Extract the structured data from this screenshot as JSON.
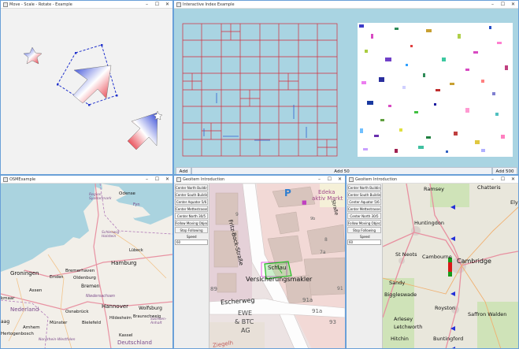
{
  "win1": {
    "title": "Move - Scale - Rotate - Example"
  },
  "win2": {
    "title": "Interactive Index Example",
    "buttons": {
      "add": "Add",
      "add50": "Add 50",
      "add500": "Add 500"
    }
  },
  "win3": {
    "title": "OSMExample",
    "labels": {
      "odense": "Odense",
      "fyn": "Fyn",
      "syddanmark": "Region Syddanmark",
      "schleswig": "Schleswig-Holstein",
      "lubeck": "Lübeck",
      "hamburg": "Hamburg",
      "groningen": "Groningen",
      "bremerhaven": "Bremerhaven",
      "oldenburg": "Oldenburg",
      "bremen": "Bremen",
      "emden": "Emden",
      "assen": "Assen",
      "niedersachsen": "Niedersachsen",
      "hannover": "Hannover",
      "wolfsburg": "Wolfsburg",
      "braunschweig": "Braunschweig",
      "osnabruck": "Osnabrück",
      "bielefeld": "Bielefeld",
      "munster": "Münster",
      "arnhem": "Arnhem",
      "hildesheim": "Hildesheim",
      "sachsen_anhalt": "Sachsen-Anhalt",
      "hertogenbosch": "Hertogenbosch",
      "nederland": "Nederland",
      "deutschland": "Deutschland",
      "nrw": "Nordrhein-Westfalen",
      "kmaar": "kmaar",
      "aag": "aag",
      "kassel": "Kassel"
    }
  },
  "win4": {
    "title": "Geoitem Introduction",
    "buttons": [
      "Center North Building",
      "Center South Building",
      "Center Aquator 5/6",
      "Center Mettestrasse 10/6",
      "Center North 30/5",
      "Follow Moving Object",
      "Stop Following",
      "Speed"
    ],
    "speed": "60",
    "labels": {
      "edeka": "Edeka",
      "aktiv_markt": "aktiv Markt",
      "fritz_bock": "Fritz-Bock-Straße",
      "escherweg": "Escherweg",
      "versicherungsmakler": "Versicherungsmakler",
      "ewe": "EWE",
      "btc": "& BTC",
      "ag": "AG",
      "n9": "9",
      "n89": "89",
      "n91a": "91a",
      "n91a2": "91a",
      "n91": "91",
      "n93": "93",
      "n8": "8",
      "n7a": "7a",
      "n7c": "7c",
      "n9b": "9b",
      "schlau": "Schlau",
      "stra_e": "Straße",
      "ziegelh": "Ziegelh"
    }
  },
  "win5": {
    "title": "Geoitem Introduction",
    "buttons": [
      "Center North Building",
      "Center South Building",
      "Center Aquator 5/6",
      "Center Mettestrasse 10/6",
      "Center North 30/5",
      "Follow Moving Object",
      "Stop Following",
      "Speed"
    ],
    "speed": "60",
    "labels": {
      "ramsey": "Ramsey",
      "chatteris": "Chatteris",
      "ely": "Ely",
      "huntingdon": "Huntingdon",
      "st_neots": "St Neots",
      "cambourne": "Cambourne",
      "cambridge": "Cambridge",
      "sandy": "Sandy",
      "biggleswade": "Biggleswade",
      "royston": "Royston",
      "arlesey": "Arlesey",
      "letchworth": "Letchworth",
      "saffron_walden": "Saffron Walden",
      "hitchin": "Hitchin",
      "buntingford": "Buntingford"
    }
  },
  "colors": {
    "accent": "#1e73c8",
    "grid_bg": "#a9d4e2",
    "grid_line": "#d42b3a",
    "land": "#f2efe9",
    "water": "#aad3df",
    "arrow_blue": "#3b4fd8",
    "arrow_red": "#e0303a"
  }
}
